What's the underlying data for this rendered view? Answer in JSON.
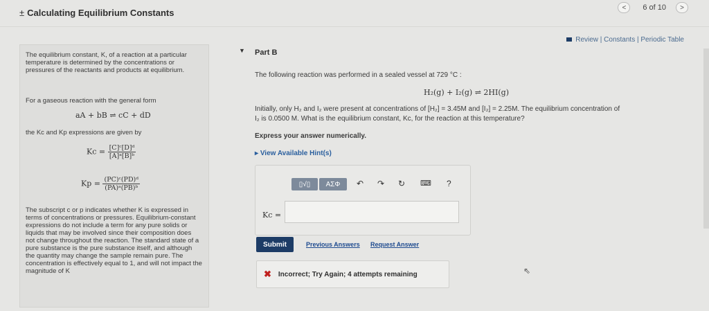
{
  "header": {
    "title_icon": "±",
    "title": "Calculating Equilibrium Constants",
    "pager": {
      "prev_label": "<",
      "count": "6 of 10",
      "next_label": ">"
    }
  },
  "top_links": "Review | Constants | Periodic Table",
  "sidebar": {
    "p1": "The equilibrium constant, K, of a reaction at a particular temperature is determined by the concentrations or pressures of the reactants and products at equilibrium.",
    "p2": "For a gaseous reaction with the general form",
    "general_form": "aA + bB ⇌ cC + dD",
    "p3": "the Kc and Kp expressions are given by",
    "kc_lhs": "Kc =",
    "kc_num": "[C]ᶜ[D]ᵈ",
    "kc_den": "[A]ᵃ[B]ᵇ",
    "kp_lhs": "Kp =",
    "kp_num": "(PC)ᶜ(PD)ᵈ",
    "kp_den": "(PA)ᵃ(PB)ᵇ",
    "p4": "The subscript c or p indicates whether K is expressed in terms of concentrations or pressures. Equilibrium-constant expressions do not include a term for any pure solids or liquids that may be involved since their composition does not change throughout the reaction. The standard state of a pure substance is the pure substance itself, and although the quantity may change the sample remain pure. The concentration is effectively equal to 1, and will not impact the magnitude of K"
  },
  "part": {
    "title": "Part B",
    "intro": "The following reaction was performed in a sealed vessel at 729 °C :",
    "reaction": "H₂(g) + I₂(g) ⇌ 2HI(g)",
    "line1": "Initially, only H₂ and I₂ were present at concentrations of [H₂] = 3.45M and [I₂] = 2.25M. The equilibrium concentration of",
    "line2": "I₂ is 0.0500 M. What is the equilibrium constant, Kc, for the reaction at this temperature?",
    "instruction": "Express your answer numerically.",
    "hint_link": "View Available Hint(s)"
  },
  "answer": {
    "toolbar": {
      "templates_label": "▯√▯",
      "symbols_label": "ΑΣΦ",
      "keyboard_label": "⌨",
      "help_label": "?"
    },
    "kc_label": "Kc =",
    "value": ""
  },
  "actions": {
    "submit_label": "Submit",
    "previous_answers_label": "Previous Answers",
    "request_answer_label": "Request Answer"
  },
  "feedback": {
    "icon": "✖",
    "message": "Incorrect; Try Again; 4 attempts remaining"
  },
  "colors": {
    "submit": "#1d3c66",
    "error": "#c0201e",
    "link": "#2a5f9e"
  }
}
